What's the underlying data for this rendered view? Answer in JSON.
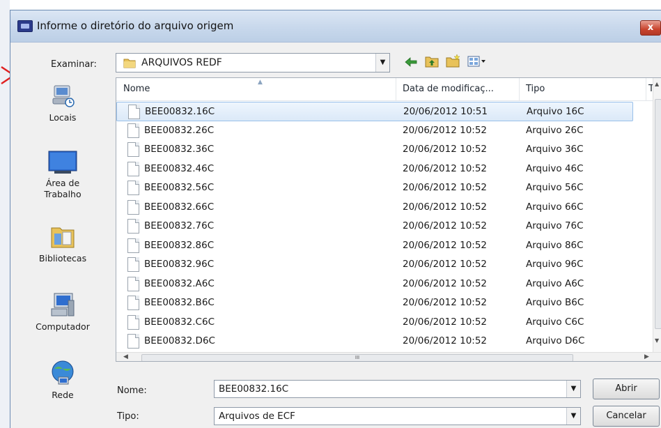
{
  "window": {
    "title": "Informe o diretório do arquivo origem",
    "close_glyph": "x"
  },
  "look_in": {
    "label": "Examinar:",
    "value": "ARQUIVOS REDF"
  },
  "places": [
    {
      "label": "Locais",
      "icon": "recent-places-icon"
    },
    {
      "label": "Área de Trabalho",
      "icon": "desktop-icon"
    },
    {
      "label": "Bibliotecas",
      "icon": "libraries-icon"
    },
    {
      "label": "Computador",
      "icon": "computer-icon"
    },
    {
      "label": "Rede",
      "icon": "network-icon"
    }
  ],
  "columns": {
    "name": "Nome",
    "date": "Data de modificaç...",
    "type": "Tipo",
    "extra": "T"
  },
  "files": [
    {
      "name": "BEE00832.16C",
      "date": "20/06/2012 10:51",
      "type": "Arquivo 16C",
      "selected": true
    },
    {
      "name": "BEE00832.26C",
      "date": "20/06/2012 10:52",
      "type": "Arquivo 26C"
    },
    {
      "name": "BEE00832.36C",
      "date": "20/06/2012 10:52",
      "type": "Arquivo 36C"
    },
    {
      "name": "BEE00832.46C",
      "date": "20/06/2012 10:52",
      "type": "Arquivo 46C"
    },
    {
      "name": "BEE00832.56C",
      "date": "20/06/2012 10:52",
      "type": "Arquivo 56C"
    },
    {
      "name": "BEE00832.66C",
      "date": "20/06/2012 10:52",
      "type": "Arquivo 66C"
    },
    {
      "name": "BEE00832.76C",
      "date": "20/06/2012 10:52",
      "type": "Arquivo 76C"
    },
    {
      "name": "BEE00832.86C",
      "date": "20/06/2012 10:52",
      "type": "Arquivo 86C"
    },
    {
      "name": "BEE00832.96C",
      "date": "20/06/2012 10:52",
      "type": "Arquivo 96C"
    },
    {
      "name": "BEE00832.A6C",
      "date": "20/06/2012 10:52",
      "type": "Arquivo A6C"
    },
    {
      "name": "BEE00832.B6C",
      "date": "20/06/2012 10:52",
      "type": "Arquivo B6C"
    },
    {
      "name": "BEE00832.C6C",
      "date": "20/06/2012 10:52",
      "type": "Arquivo C6C"
    },
    {
      "name": "BEE00832.D6C",
      "date": "20/06/2012 10:52",
      "type": "Arquivo D6C"
    }
  ],
  "filename": {
    "label": "Nome:",
    "value": "BEE00832.16C"
  },
  "filetype": {
    "label": "Tipo:",
    "value": "Arquivos de ECF"
  },
  "buttons": {
    "open": "Abrir",
    "cancel": "Cancelar"
  },
  "scroll": {
    "h_grip": "III"
  },
  "colors": {
    "selection": "#dbe9f8",
    "title_bar": "#c8d8ec",
    "close": "#c9442e",
    "marker": "#e02020"
  }
}
